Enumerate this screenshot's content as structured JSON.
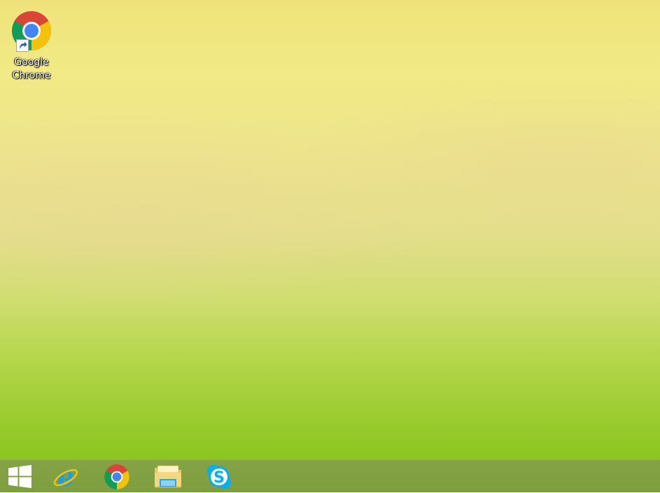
{
  "desktop": {
    "icons": [
      {
        "label": "Google\nChrome",
        "icon": "chrome-icon",
        "shortcut": true
      }
    ]
  },
  "taskbar": {
    "start_icon": "windows-logo-icon",
    "pinned": [
      {
        "name": "Internet Explorer",
        "icon": "internet-explorer-icon"
      },
      {
        "name": "Google Chrome",
        "icon": "chrome-icon"
      },
      {
        "name": "File Explorer",
        "icon": "file-explorer-icon"
      },
      {
        "name": "Skype",
        "icon": "skype-icon"
      }
    ]
  },
  "colors": {
    "wallpaper_top": "#efe27a",
    "wallpaper_bottom": "#8cc61f",
    "taskbar": "#7f9e40",
    "chrome_red": "#db4437",
    "chrome_yellow": "#f4c20d",
    "chrome_green": "#0f9d58",
    "chrome_blue": "#4285f4",
    "skype_blue": "#00aff0",
    "ie_blue": "#1ea0e0"
  }
}
